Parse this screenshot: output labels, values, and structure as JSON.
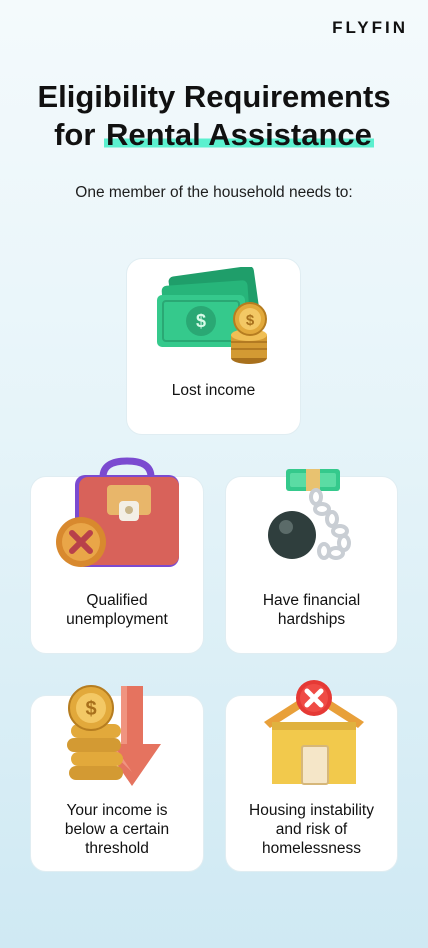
{
  "brand": "FLYFIN",
  "title": {
    "line1": "Eligibility Requirements",
    "line2_prefix": "for ",
    "line2_highlight": "Rental Assistance"
  },
  "subtitle": "One member of the household needs to:",
  "cards": [
    {
      "label": "Lost income",
      "icon": "money-coins-icon"
    },
    {
      "label_lines": [
        "Qualified",
        "unemployment"
      ],
      "icon": "briefcase-x-icon"
    },
    {
      "label_lines": [
        "Have financial",
        "hardships"
      ],
      "icon": "ball-chain-money-icon"
    },
    {
      "label_lines": [
        "Your income is",
        "below a certain",
        "threshold"
      ],
      "icon": "coins-down-arrow-icon"
    },
    {
      "label_lines": [
        "Housing instability",
        "and risk of",
        "homelessness"
      ],
      "icon": "house-x-icon"
    }
  ],
  "colors": {
    "accent_highlight": "#5cf0cf",
    "money_green": "#35c98c",
    "coin_gold": "#e2a93b",
    "alert_red": "#e53935"
  }
}
